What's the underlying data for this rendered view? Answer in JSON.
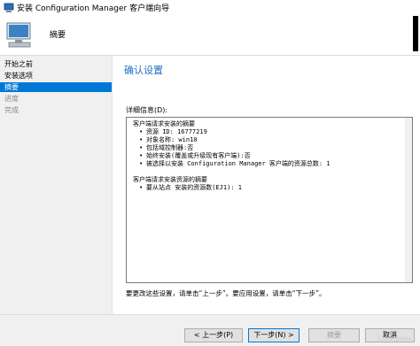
{
  "window": {
    "title": "安装 Configuration Manager 客户端向导"
  },
  "header": {
    "title": "摘要"
  },
  "sidebar": {
    "items": [
      {
        "label": "开始之前"
      },
      {
        "label": "安装选项"
      },
      {
        "label": "摘要"
      },
      {
        "label": "进度"
      },
      {
        "label": "完成"
      }
    ]
  },
  "main": {
    "title": "确认设置",
    "details_label": "详细信息(D):",
    "details": {
      "group1_title": "客户端请求安装的摘要",
      "group1_items": [
        "资源 ID: 16777219",
        "对象名称: win10",
        "包括域控制器:否",
        "始终安装(覆盖或升级现有客户端):否",
        "被选择以安装 Configuration Manager 客户端的资源总数: 1"
      ],
      "group2_title": "客户端请求安装资源的摘要",
      "group2_items": [
        "要从站点 安装的资源数(EJ1): 1"
      ]
    },
    "footer": "要更改这些设置，请单击“上一步”。要应用设置，请单击“下一步”。"
  },
  "buttons": {
    "prev": "< 上一步(P)",
    "next": "下一步(N) >",
    "summary": "摘要",
    "cancel": "取消"
  },
  "watermark": "CSDN @Vide..."
}
